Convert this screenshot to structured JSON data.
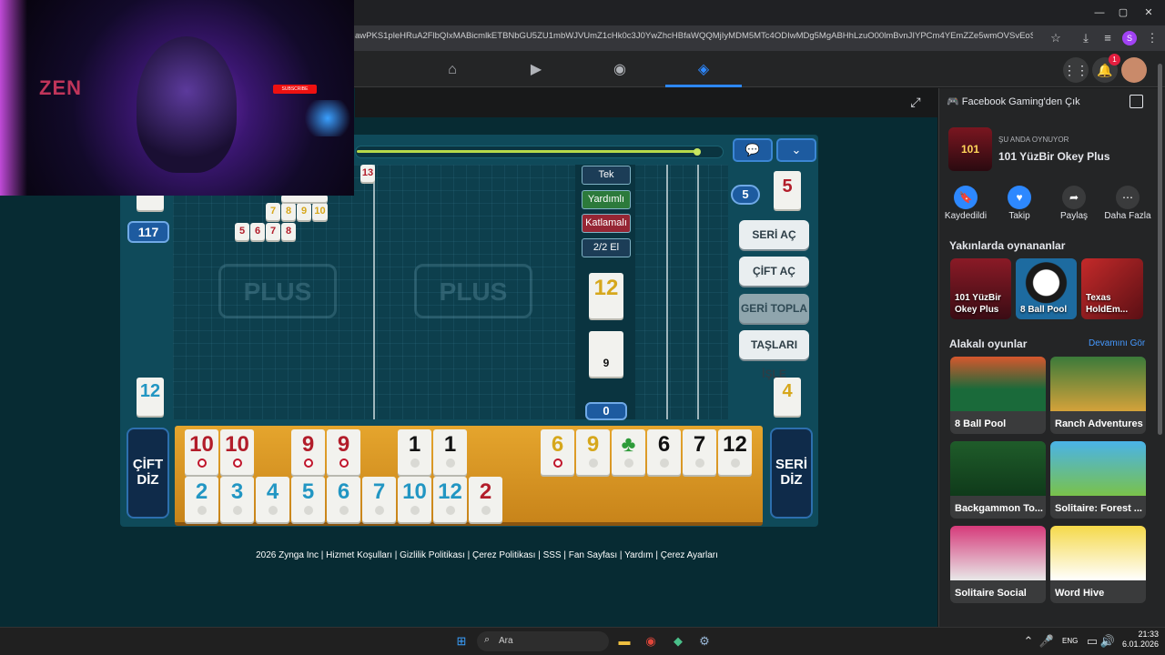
{
  "browser": {
    "url": "awPKS1pleHRuA2FlbQIxMABicmlkETBNbGU5ZU1mbWJVUmZ1cHk0c3J0YwZhcHBfaWQQMjIyMDM5MTc4ODIwMDg5MgABHhLzuO00lmBvnJIYPCm4YEmZZe5wmOVSvEoS5IWIETyPP5...",
    "profile_initial": "S",
    "window_controls": [
      "—",
      "▢",
      "✕"
    ]
  },
  "fb": {
    "notification_count": "1"
  },
  "overlay": {
    "brand": "ZEN",
    "youtube": "SUBSCRIBE"
  },
  "game": {
    "left_count": "117",
    "right_count": "5",
    "table_tile": "13",
    "top_right_tile": "5",
    "left_bottom_tile": "12",
    "right_bottom_tile": "4",
    "center_count": "0",
    "deck_tile_top": "12",
    "deck_tile_bottom": "9",
    "tags": {
      "tek": "Tek",
      "yardimli": "Yardımlı",
      "katlamali": "Katlamalı",
      "el": "2/2 El"
    },
    "buttons": {
      "seri_ac": "SERİ AÇ",
      "cift_ac": "ÇİFT AÇ",
      "geri_topla": "GERİ TOPLA",
      "taslari_isle": "TAŞLARI İŞLE",
      "cift_diz_1": "ÇİFT",
      "cift_diz_2": "DİZ",
      "seri_diz_1": "SERİ",
      "seri_diz_2": "DİZ"
    },
    "meld1": [
      "7",
      "8",
      "9",
      "10"
    ],
    "meld2": [
      "5",
      "6",
      "7",
      "8"
    ],
    "rack_top": [
      "10",
      "10",
      "9",
      "9",
      "1",
      "1",
      "6",
      "9",
      "♣",
      "6",
      "7",
      "12"
    ],
    "rack_bottom": [
      "2",
      "3",
      "4",
      "5",
      "6",
      "7",
      "10",
      "12",
      "2"
    ],
    "footer": "2026 Zynga Inc | Hizmet Koşulları | Gizlilik Politikası | Çerez Politikası | SSS | Fan Sayfası | Yardım | Çerez Ayarları"
  },
  "sidebar": {
    "exit_label": "Facebook Gaming'den Çık",
    "now_playing": "ŞU ANDA OYNUYOR",
    "game_name": "101 YüzBir Okey Plus",
    "actions": [
      "Kaydedildi",
      "Takip",
      "Paylaş",
      "Daha Fazla"
    ],
    "recent_title": "Yakınlarda oynananlar",
    "recent": [
      {
        "line1": "101 YüzBir",
        "line2": "Okey Plus"
      },
      {
        "line1": "8 Ball Pool",
        "line2": ""
      },
      {
        "line1": "Texas",
        "line2": "HoldEm..."
      }
    ],
    "related_title": "Alakalı oyunlar",
    "see_all": "Devamını Gör",
    "related": [
      "8 Ball Pool",
      "Ranch Adventures",
      "Backgammon To...",
      "Solitaire: Forest ...",
      "Solitaire Social",
      "Word Hive"
    ]
  },
  "taskbar": {
    "search_placeholder": "Ara",
    "lang": "ENG",
    "time": "21:33",
    "date": "6.01.2026"
  }
}
